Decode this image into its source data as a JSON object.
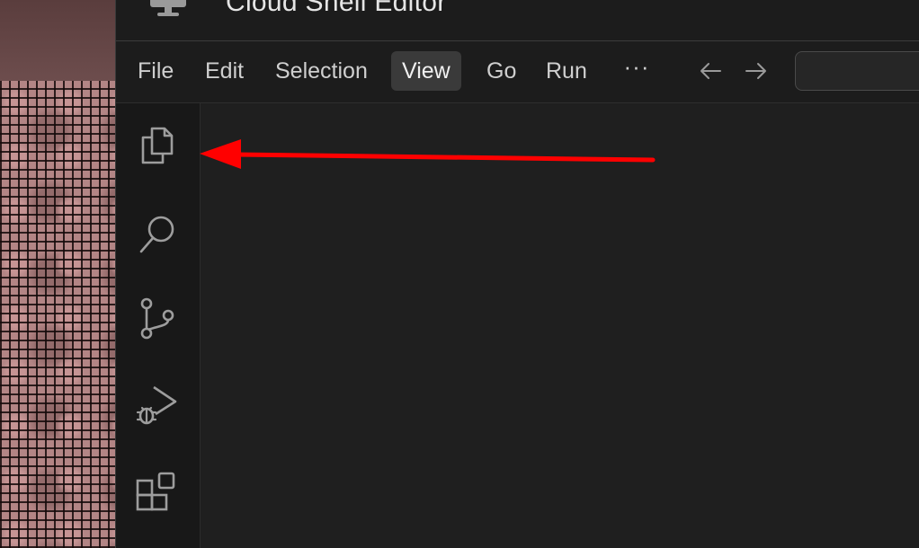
{
  "window": {
    "title": "Cloud Shell Editor"
  },
  "menubar": {
    "items": [
      {
        "label": "File"
      },
      {
        "label": "Edit"
      },
      {
        "label": "Selection"
      },
      {
        "label": "View",
        "active": true
      },
      {
        "label": "Go"
      },
      {
        "label": "Run"
      }
    ],
    "more_label": "···"
  },
  "activity_bar": {
    "icons": [
      "explorer-icon",
      "search-icon",
      "source-control-icon",
      "run-debug-icon",
      "extensions-icon"
    ]
  },
  "colors": {
    "annotation_arrow": "#ff0000",
    "active_menu_bg": "#3a3a3a",
    "editor_bg": "#1f1f1f"
  }
}
